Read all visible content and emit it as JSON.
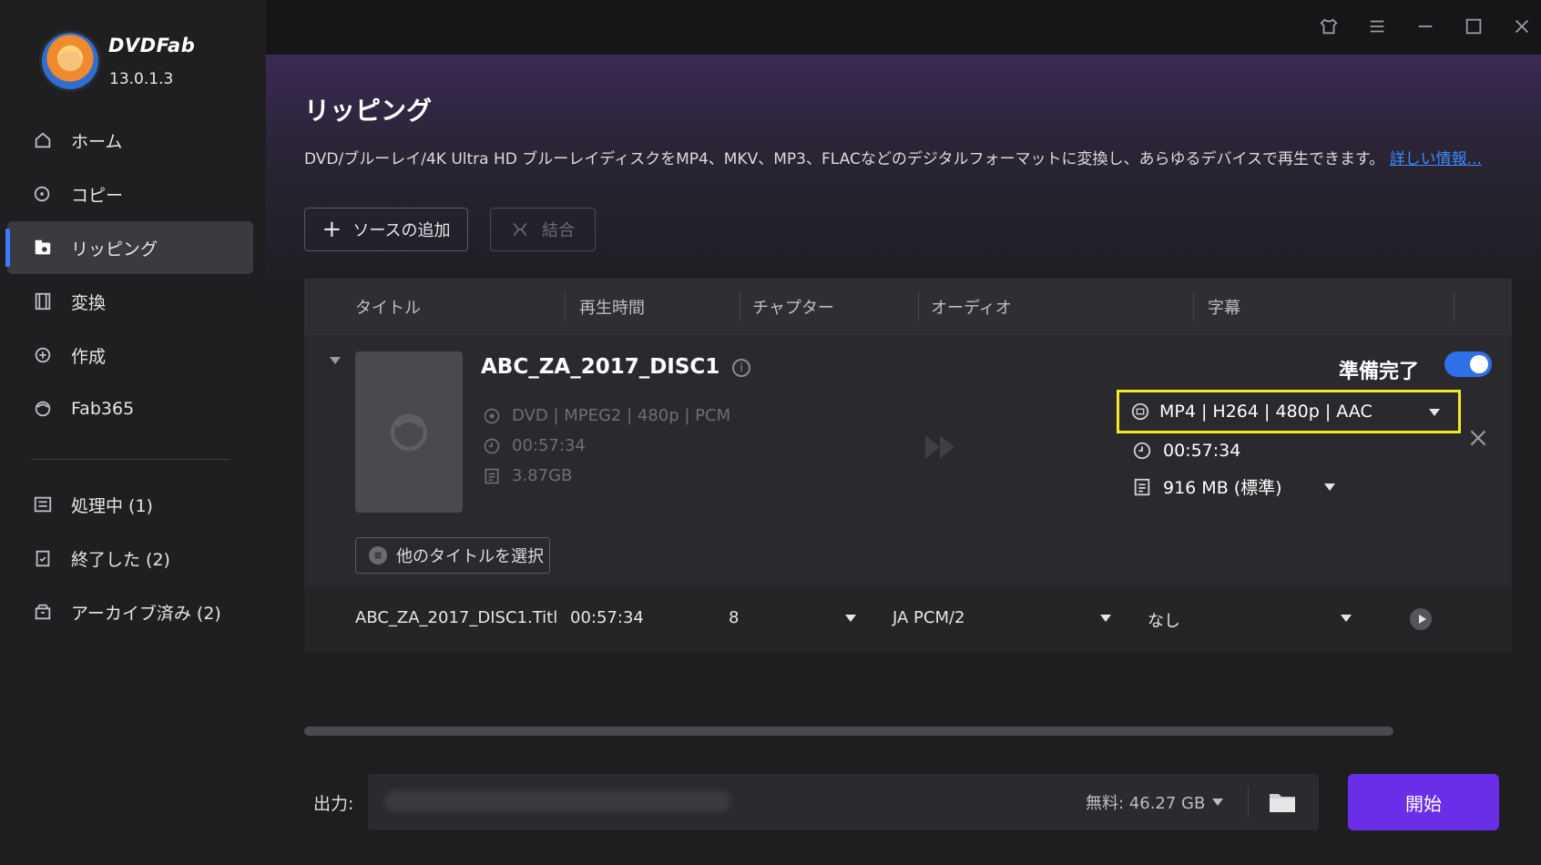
{
  "app": {
    "brand": "DVDFab",
    "version": "13.0.1.3"
  },
  "sidebar": {
    "items": [
      {
        "label": "ホーム",
        "icon": "home-icon"
      },
      {
        "label": "コピー",
        "icon": "copy-icon"
      },
      {
        "label": "リッピング",
        "icon": "ripper-icon",
        "active": true
      },
      {
        "label": "変換",
        "icon": "convert-icon"
      },
      {
        "label": "作成",
        "icon": "create-icon"
      },
      {
        "label": "Fab365",
        "icon": "fab365-icon"
      }
    ],
    "tasks": [
      {
        "label": "処理中 (1)",
        "icon": "processing-icon"
      },
      {
        "label": "終了した (2)",
        "icon": "finished-icon"
      },
      {
        "label": "アーカイブ済み (2)",
        "icon": "archive-icon"
      }
    ]
  },
  "main": {
    "title": "リッピング",
    "description": "DVD/ブルーレイ/4K Ultra HD ブルーレイディスクをMP4、MKV、MP3、FLACなどのデジタルフォーマットに変換し、あらゆるデバイスで再生できます。",
    "more_link": "詳しい情報...",
    "add_source": "ソースの追加",
    "merge": "結合"
  },
  "table": {
    "headers": [
      "タイトル",
      "再生時間",
      "チャプター",
      "オーディオ",
      "字幕"
    ],
    "item": {
      "title": "ABC_ZA_2017_DISC1",
      "source_format": "DVD | MPEG2 | 480p | PCM",
      "source_duration": "00:57:34",
      "source_size": "3.87GB",
      "status": "準備完了",
      "ready_toggle": true,
      "profile": "MP4 | H264 | 480p | AAC",
      "output_duration": "00:57:34",
      "output_size": "916 MB (標準)",
      "other_titles_button": "他のタイトルを選択"
    },
    "subrow": {
      "title": "ABC_ZA_2017_DISC1.Titl",
      "duration": "00:57:34",
      "chapters": "8",
      "audio": "JA  PCM/2",
      "subtitle": "なし"
    }
  },
  "output": {
    "label": "出力:",
    "free_space": "無料: 46.27 GB",
    "start_button": "開始"
  },
  "colors": {
    "accent": "#3d7cff",
    "start": "#6a2de8",
    "highlight": "#f2ea22"
  }
}
